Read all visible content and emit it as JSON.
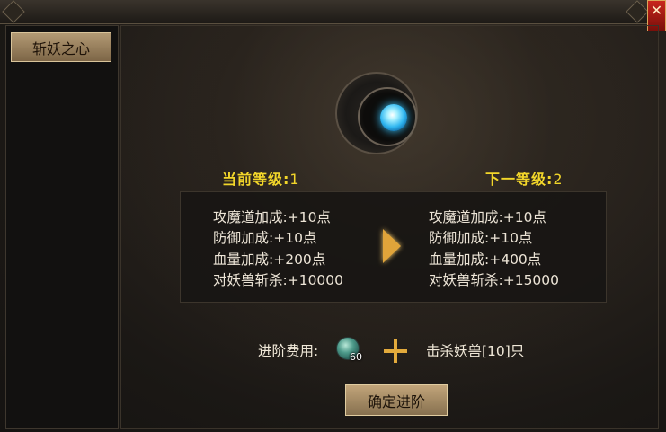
{
  "window": {
    "close_label": "✕"
  },
  "sidebar": {
    "items": [
      {
        "label": "斩妖之心"
      }
    ]
  },
  "upgrade": {
    "current_level_label": "当前等级:",
    "current_level_value": "1",
    "next_level_label": "下一等级:",
    "next_level_value": "2",
    "current_stats": [
      "攻魔道加成:+10点",
      "防御加成:+10点",
      "血量加成:+200点",
      "对妖兽斩杀:+10000"
    ],
    "next_stats": [
      "攻魔道加成:+10点",
      "防御加成:+10点",
      "血量加成:+400点",
      "对妖兽斩杀:+15000"
    ],
    "cost_label": "进阶费用:",
    "cost_item_count": "60",
    "cost_condition": "击杀妖兽[10]只",
    "confirm_label": "确定进阶"
  },
  "colors": {
    "level_text": "#f2d62a",
    "stat_text": "#ece4d6",
    "arrow": "#e0a43a",
    "orb": "#2fb6f0"
  },
  "icons": {
    "close": "close-icon",
    "orb": "soul-orb-icon",
    "arrow": "arrow-right-icon",
    "cost_item": "jade-item-icon",
    "plus": "plus-icon"
  }
}
